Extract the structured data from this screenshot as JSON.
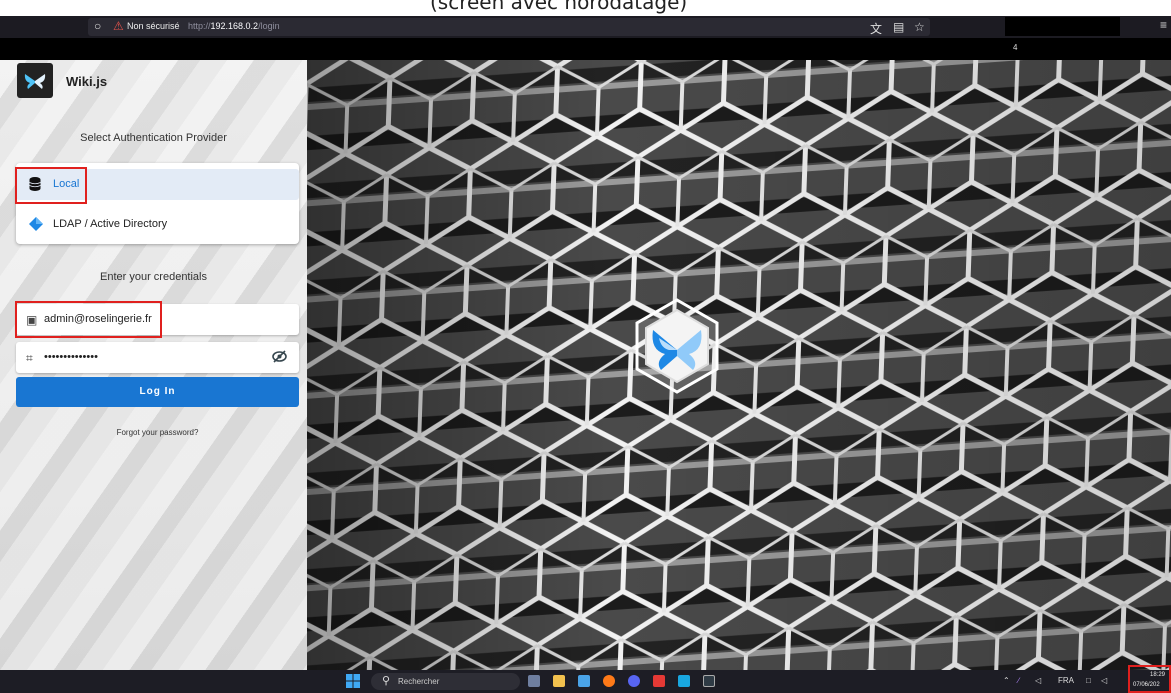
{
  "caption": "(screen avec horodatage)",
  "browser": {
    "not_secure_label": "Non sécurisé",
    "url_prefix": "http://",
    "url_host": "192.168.0.2",
    "url_path": "/login",
    "bookmark_badge": "4"
  },
  "app": {
    "brand": "Wiki.js",
    "select_provider_heading": "Select Authentication Provider",
    "providers": [
      {
        "label": "Local",
        "icon": "database-icon",
        "selected": true
      },
      {
        "label": "LDAP / Active Directory",
        "icon": "diamond-icon",
        "selected": false
      }
    ],
    "credentials_heading": "Enter your credentials",
    "email_value": "admin@roselingerie.fr",
    "password_value": "••••••••••••••",
    "login_button": "Log In",
    "forgot_link": "Forgot your password?"
  },
  "taskbar": {
    "search_placeholder": "Rechercher",
    "lang": "FRA",
    "time": "18:29",
    "date": "07/06/202"
  },
  "colors": {
    "primary": "#1976d2",
    "highlight_red": "#e0201e",
    "selected_provider_bg": "#e3ebf6"
  }
}
